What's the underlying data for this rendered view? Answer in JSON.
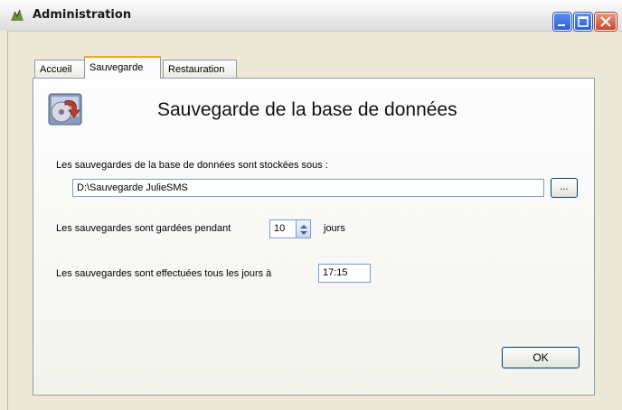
{
  "window": {
    "title": "Administration",
    "icon": "app-icon"
  },
  "tabs": [
    {
      "label": "Accueil",
      "selected": false
    },
    {
      "label": "Sauvegarde",
      "selected": true
    },
    {
      "label": "Restauration",
      "selected": false
    }
  ],
  "backup": {
    "header_title": "Sauvegarde de la base de données",
    "header_icon": "backup-database-icon",
    "path_label": "Les sauvegardes de la base de données sont stockées sous :",
    "path_value": "D:\\Sauvegarde JulieSMS",
    "browse_label": "...",
    "keep_label": "Les sauvegardes sont gardées pendant",
    "keep_days": "10",
    "keep_unit": "jours",
    "time_label": "Les sauvegardes sont effectuées tous les jours à",
    "time_value": "17:15",
    "ok_label": "OK"
  },
  "colors": {
    "selected_tab_accent": "#f5a623",
    "input_border": "#7f9db9",
    "close_button": "#c8462a",
    "title_buttons": "#2a5fd9"
  }
}
